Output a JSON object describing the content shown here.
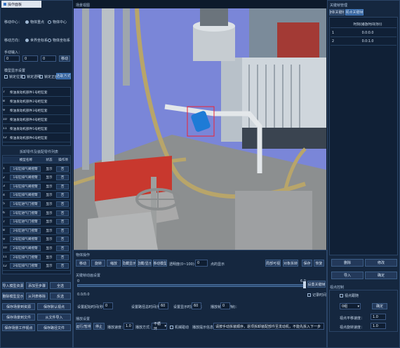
{
  "window": {
    "title": "操作面板"
  },
  "viewport": {
    "title": "场景视图"
  },
  "move_center": {
    "label": "移动中心：",
    "opt1": "物体重点",
    "opt2": "物体中心"
  },
  "move_dir": {
    "label": "移动方向：",
    "opt1": "世界坐标系",
    "opt2": "物体坐标系"
  },
  "manual_input": {
    "label": "手动输入：",
    "x": "0",
    "y": "0",
    "z": "0",
    "move_btn": "移动"
  },
  "display_settings": {
    "label": "模型显示设置",
    "opts": [
      "锁定位置",
      "锁定透明",
      "锁定正面",
      "选取方式"
    ]
  },
  "upper_rows": [
    {
      "n": "7",
      "name": "柴油发动机部件1号柜缸套"
    },
    {
      "n": "8",
      "name": "柴油发动机部件2号柜缸套"
    },
    {
      "n": "9",
      "name": "柴油发动机部件3号柜缸套"
    },
    {
      "n": "10",
      "name": "柴油发动机部件4号柜缸套"
    },
    {
      "n": "11",
      "name": "柴油发动机部件5号柜缸套"
    },
    {
      "n": "12",
      "name": "柴油发动机部件6号柜缸套"
    }
  ],
  "list": {
    "title": "拆卸零件及装配零件列表",
    "headers": [
      "",
      "模型名称",
      "状态",
      "操作项"
    ],
    "rows": [
      {
        "n": "1",
        "name": "1号缸排气阀摇臂",
        "state": "显示",
        "op": "否"
      },
      {
        "n": "2",
        "name": "1号缸排气阀摇臂",
        "state": "显示",
        "op": "否"
      },
      {
        "n": "3",
        "name": "1号缸排气阀摇臂",
        "state": "显示",
        "op": "否"
      },
      {
        "n": "4",
        "name": "1号缸排气阀摇臂",
        "state": "显示",
        "op": "否"
      },
      {
        "n": "5",
        "name": "1号缸进气门摇臂",
        "state": "显示",
        "op": "否"
      },
      {
        "n": "6",
        "name": "1号缸进气门摇臂",
        "state": "显示",
        "op": "否"
      },
      {
        "n": "7",
        "name": "1号缸进气门摇臂",
        "state": "显示",
        "op": "否"
      },
      {
        "n": "8",
        "name": "2号缸进气门摇臂",
        "state": "显示",
        "op": "否"
      },
      {
        "n": "9",
        "name": "2号缸排气阀摇臂",
        "state": "显示",
        "op": "否"
      },
      {
        "n": "10",
        "name": "2号缸排气阀摇臂",
        "state": "显示",
        "op": "否"
      },
      {
        "n": "11",
        "name": "2号缸排气门摇臂",
        "state": "显示",
        "op": "否"
      },
      {
        "n": "12",
        "name": "2号缸排气门摇臂",
        "state": "显示",
        "op": "否"
      }
    ]
  },
  "left_buttons": {
    "r1": [
      "导入模型资源",
      "添加至步骤",
      "全选"
    ],
    "r2": [
      "删除模型显示",
      "从列表移除",
      "反选"
    ],
    "r3": [
      "保存场景到资源",
      "保存默认视点"
    ],
    "r4": [
      "保存场景到文件",
      "从文件导入"
    ],
    "r5": [
      "保存场景工作视点",
      "保存路径文件"
    ]
  },
  "part_ops": {
    "title": "物体操作",
    "buttons": [
      "移动",
      "旋转",
      "缩放",
      "隐藏显示",
      "隐藏/显示",
      "移动模型"
    ],
    "transparency_label": "透明度(0~100)：",
    "transparency_value": "0",
    "transparency_unit": "点的显示",
    "right_buttons": [
      "局部可视",
      "对象拆转",
      "保存",
      "恢复"
    ]
  },
  "animation": {
    "title": "关键帧动画设置",
    "start": "0",
    "end": "6.0",
    "save_btn": "设置关键帧",
    "time_display": "0.0/0.0",
    "record_label": "记录时间",
    "fields": [
      {
        "label": "设置起始时间(秒)：",
        "value": "0"
      },
      {
        "label": "设置路径总时间(秒)：",
        "value": "60"
      },
      {
        "label": "设置显示时间(秒)：",
        "value": "60"
      },
      {
        "label": "播放帧速(秒/帧)：",
        "value": "0"
      }
    ]
  },
  "playback": {
    "title": "播放设置",
    "play": "运行/暂停",
    "stop": "停止",
    "speed_label": "播放速度：",
    "speed_value": "1.0",
    "mode_label": "播放方式：",
    "mode_value": "不循环",
    "follow_label": "机械碰动",
    "hint_label": "播放提示信息：",
    "hint_text": "请按手动拆装顺序，逐项拆卸装配部件至发动机，不能先拆入下一步"
  },
  "keyframe_mgr": {
    "title": "关键帧管理",
    "tabs": [
      "物体关键帧",
      "视点关键帧"
    ],
    "header": "时刻(播放时间(秒))",
    "rows": [
      {
        "n": "1",
        "t": "0.0:0.0"
      },
      {
        "n": "2",
        "t": "0.0:1.0"
      }
    ],
    "buttons": [
      "删除",
      "修改",
      "导入",
      "确定"
    ]
  },
  "view_settings": {
    "title": "视点控制",
    "follow_label": "视点跟随",
    "combo_value": "0组",
    "confirm_btn": "确定",
    "move_speed_label": "视点平移速度：",
    "move_speed": "1.0",
    "rotate_speed_label": "视点旋转速度：",
    "rotate_speed": "1.0"
  },
  "colors": {
    "accent": "#2b5a96",
    "panel": "#15273f",
    "bg": "#0d1a2b"
  }
}
